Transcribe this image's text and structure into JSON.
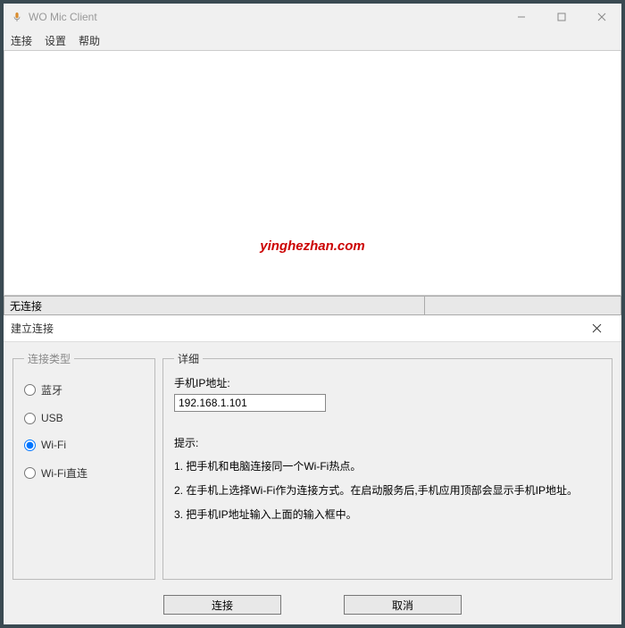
{
  "main": {
    "title": "WO Mic Client",
    "menu": {
      "connect": "连接",
      "settings": "设置",
      "help": "帮助"
    },
    "watermark": "yinghezhan.com",
    "status": "无连接"
  },
  "dialog": {
    "title": "建立连接",
    "group_type_label": "连接类型",
    "group_detail_label": "详细",
    "radios": {
      "bluetooth": "蓝牙",
      "usb": "USB",
      "wifi": "Wi-Fi",
      "wifi_direct": "Wi-Fi直连"
    },
    "selected": "wifi",
    "ip_label": "手机IP地址:",
    "ip_value": "192.168.1.101",
    "hint_title": "提示:",
    "hints": [
      "1. 把手机和电脑连接同一个Wi-Fi热点。",
      "2. 在手机上选择Wi-Fi作为连接方式。在启动服务后,手机应用顶部会显示手机IP地址。",
      "3. 把手机IP地址输入上面的输入框中。"
    ],
    "buttons": {
      "connect": "连接",
      "cancel": "取消"
    }
  }
}
